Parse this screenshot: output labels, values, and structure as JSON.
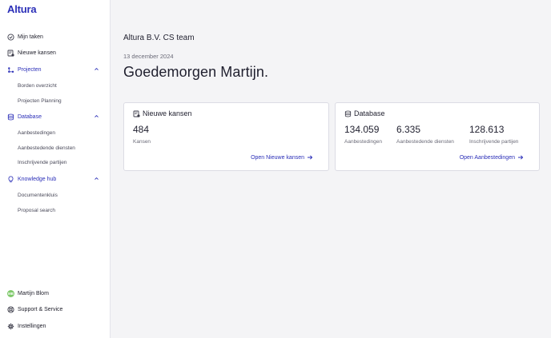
{
  "app": {
    "logo": "Altura"
  },
  "sidebar": {
    "mijn_taken": "Mijn taken",
    "nieuwe_kansen": "Nieuwe kansen",
    "projecten": {
      "label": "Projecten",
      "items": [
        "Borden overzicht",
        "Projecten Planning"
      ]
    },
    "database": {
      "label": "Database",
      "items": [
        "Aanbestedingen",
        "Aanbestedende diensten",
        "Inschrijvende partijen"
      ]
    },
    "knowledge": {
      "label": "Knowledge hub",
      "items": [
        "Documentenkluis",
        "Proposal search"
      ]
    },
    "user": {
      "name": "Martijn Blom",
      "initials": "MB"
    },
    "support": "Support & Service",
    "settings": "Instellingen"
  },
  "main": {
    "team": "Altura B.V. CS team",
    "date": "13 december 2024",
    "greeting": "Goedemorgen Martijn."
  },
  "cards": {
    "kansen": {
      "title": "Nieuwe kansen",
      "stats": [
        {
          "value": "484",
          "label": "Kansen"
        }
      ],
      "link": "Open Nieuwe kansen"
    },
    "database": {
      "title": "Database",
      "stats": [
        {
          "value": "134.059",
          "label": "Aanbestedingen"
        },
        {
          "value": "6.335",
          "label": "Aanbestedende diensten"
        },
        {
          "value": "128.613",
          "label": "Inschrijvende partijen"
        }
      ],
      "link": "Open Aanbestedingen"
    }
  },
  "colors": {
    "accent": "#2b2fb8",
    "avatar": "#7fc96b"
  }
}
